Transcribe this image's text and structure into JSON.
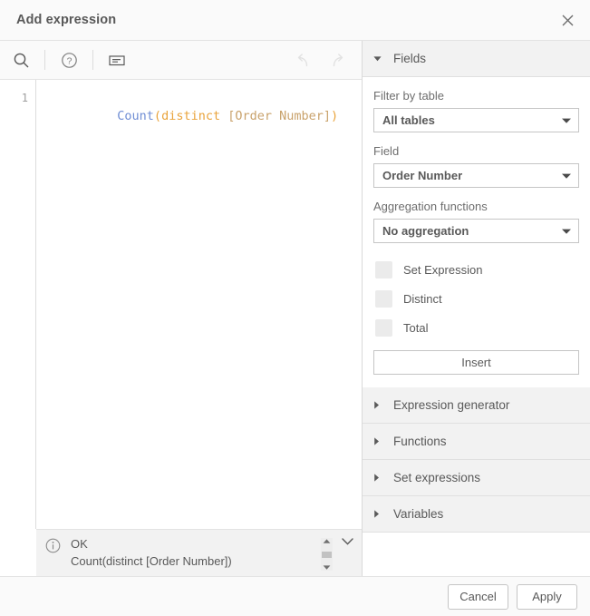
{
  "dialog": {
    "title": "Add expression",
    "close_icon": "close-icon"
  },
  "toolbar": {
    "search_icon": "search-icon",
    "help_icon": "help-circle-icon",
    "comment_icon": "comment-label-icon",
    "undo_icon": "undo-arrow-icon",
    "redo_icon": "redo-arrow-icon"
  },
  "editor": {
    "line_numbers": [
      "1"
    ],
    "expression": "Count(distinct [Order Number])",
    "tokens": [
      {
        "text": "Count",
        "type": "func"
      },
      {
        "text": "(",
        "type": "paren"
      },
      {
        "text": "distinct",
        "type": "kw"
      },
      {
        "text": " ",
        "type": "plain"
      },
      {
        "text": "[Order Number]",
        "type": "field"
      },
      {
        "text": ")",
        "type": "paren"
      }
    ]
  },
  "status": {
    "info_icon": "info-circle-icon",
    "state": "OK",
    "preview": "Count(distinct [Order Number])",
    "scroll_up_icon": "scroll-up-arrow-icon",
    "scroll_down_icon": "scroll-down-arrow-icon",
    "collapse_icon": "chevron-down-icon"
  },
  "panel": {
    "fields": {
      "header": "Fields",
      "expanded": true,
      "caret_icon": "caret-down-icon",
      "filter_by_table": {
        "label": "Filter by table",
        "value": "All tables",
        "caret_icon": "caret-down-icon"
      },
      "field": {
        "label": "Field",
        "value": "Order Number",
        "caret_icon": "caret-down-icon"
      },
      "aggregation": {
        "label": "Aggregation functions",
        "value": "No aggregation",
        "caret_icon": "caret-down-icon"
      },
      "checkboxes": [
        {
          "label": "Set Expression",
          "checked": false
        },
        {
          "label": "Distinct",
          "checked": false
        },
        {
          "label": "Total",
          "checked": false
        }
      ],
      "insert_label": "Insert"
    },
    "sections": [
      {
        "header": "Expression generator",
        "expanded": false,
        "caret_icon": "caret-right-icon"
      },
      {
        "header": "Functions",
        "expanded": false,
        "caret_icon": "caret-right-icon"
      },
      {
        "header": "Set expressions",
        "expanded": false,
        "caret_icon": "caret-right-icon"
      },
      {
        "header": "Variables",
        "expanded": false,
        "caret_icon": "caret-right-icon"
      }
    ]
  },
  "footer": {
    "cancel_label": "Cancel",
    "apply_label": "Apply"
  },
  "colors": {
    "accent_func": "#6f8dd4",
    "accent_keyword": "#e9a33b",
    "accent_field": "#c9a26b",
    "panel_header_bg": "#f2f2f2",
    "text": "#595959"
  }
}
